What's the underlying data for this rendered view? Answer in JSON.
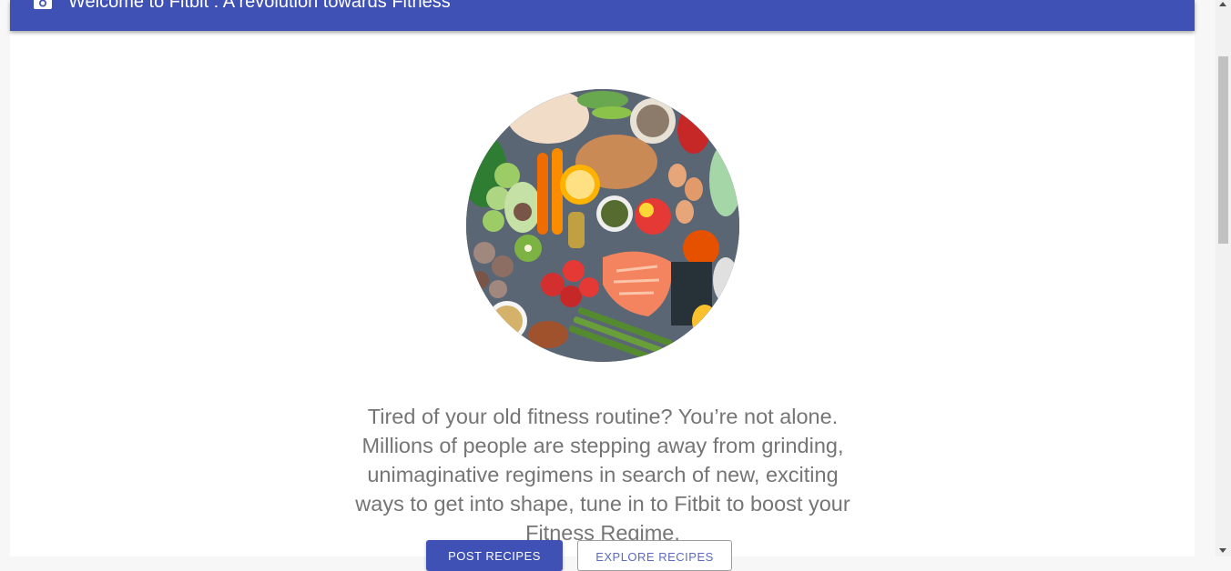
{
  "appbar": {
    "icon": "camera-icon",
    "title": "Welcome to Fitbit : A revolution towards Fitness",
    "color": "#3f51b5"
  },
  "hero": {
    "image": "healthy-food-assortment"
  },
  "main": {
    "description": "Tired of your old fitness routine? You’re not alone. Millions of people are stepping away from grinding, unimaginative regimens in search of new, exciting ways to get into shape, tune in to Fitbit to boost your Fitness Regime."
  },
  "actions": {
    "primary_label": "Post Recipes",
    "secondary_label": "Explore Recipes"
  }
}
